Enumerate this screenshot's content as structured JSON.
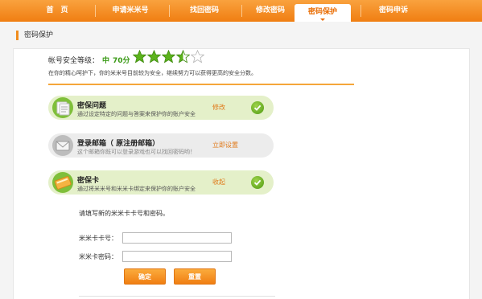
{
  "nav": {
    "items": [
      {
        "label": "首　页"
      },
      {
        "label": "申请米米号"
      },
      {
        "label": "找回密码"
      },
      {
        "label": "修改密码"
      },
      {
        "label": "密码保护",
        "active": true
      },
      {
        "label": "密码申诉"
      }
    ]
  },
  "section": {
    "title": "密码保护"
  },
  "security": {
    "label": "帐号安全等级：",
    "level": "中",
    "score": "70分",
    "stars": 3.5,
    "stars_max": 5,
    "tip": "在你的精心呵护下，你的米米号目前较为安全，继续努力可以获得更高的安全分数。"
  },
  "items": [
    {
      "title": "密保问题",
      "desc": "通过设定特定的问题与答案来保护你的账户安全",
      "action": "修改",
      "done": true
    },
    {
      "title": "登录邮箱（ 原注册邮箱）",
      "desc": "这个邮箱你既可以登录游戏也可以找回密码哟！",
      "action": "立即设置",
      "done": false
    },
    {
      "title": "密保卡",
      "desc": "通过将米米号和米米卡绑定来保护你的账户安全",
      "action": "收起",
      "done": true
    }
  ],
  "form": {
    "prompt": "请填写新的米米卡卡号和密码。",
    "card_no_label": "米米卡卡号：",
    "card_no_value": "",
    "card_pwd_label": "米米卡密码：",
    "card_pwd_value": "",
    "confirm": "确定",
    "reset": "重置"
  },
  "colors": {
    "accent": "#f07e12",
    "star": "#5cb31c",
    "green_bg": "#e4f0c9",
    "gray_bg": "#ececec"
  }
}
